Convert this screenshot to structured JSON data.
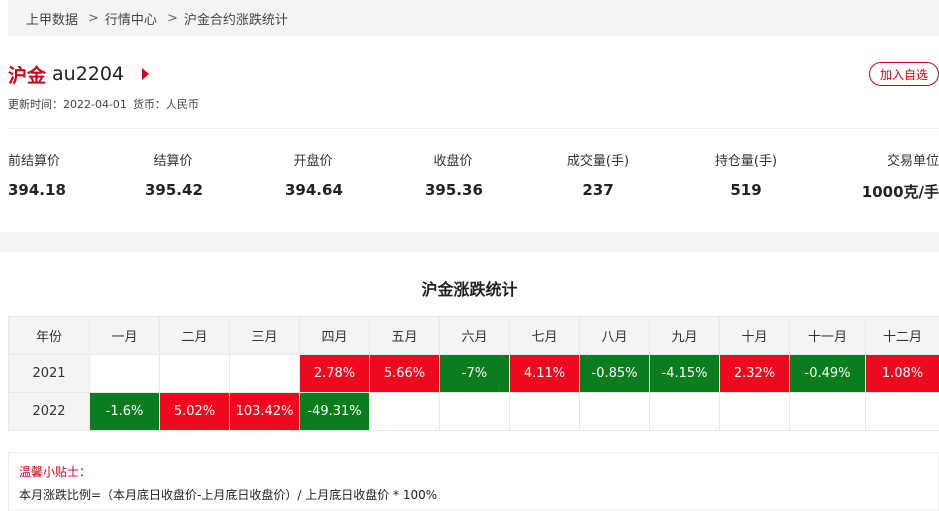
{
  "breadcrumb": {
    "items": [
      "上甲数据",
      "行情中心",
      "沪金合约涨跌统计"
    ],
    "separator": ">"
  },
  "contract": {
    "name": "沪金",
    "code": "au2204",
    "update_time": "更新时间：2022-04-01",
    "currency": "货币：人民币",
    "watch_button": "加入自选"
  },
  "stats": [
    {
      "label": "前结算价",
      "value": "394.18"
    },
    {
      "label": "结算价",
      "value": "395.42"
    },
    {
      "label": "开盘价",
      "value": "394.64"
    },
    {
      "label": "收盘价",
      "value": "395.36"
    },
    {
      "label": "成交量(手)",
      "value": "237"
    },
    {
      "label": "持仓量(手)",
      "value": "519"
    },
    {
      "label": "交易单位",
      "value": "1000克/手"
    }
  ],
  "table": {
    "title": "沪金涨跌统计",
    "headers": [
      "年份",
      "一月",
      "二月",
      "三月",
      "四月",
      "五月",
      "六月",
      "七月",
      "八月",
      "九月",
      "十月",
      "十一月",
      "十二月"
    ],
    "rows": [
      {
        "year": "2021",
        "cells": [
          "",
          "",
          "",
          "2.78%",
          "5.66%",
          "-7%",
          "4.11%",
          "-0.85%",
          "-4.15%",
          "2.32%",
          "-0.49%",
          "1.08%"
        ]
      },
      {
        "year": "2022",
        "cells": [
          "-1.6%",
          "5.02%",
          "103.42%",
          "-49.31%",
          "",
          "",
          "",
          "",
          "",
          "",
          "",
          ""
        ]
      }
    ]
  },
  "colors": {
    "accent": "#d0021b",
    "up": "#ee0a1e",
    "down": "#0b7d1e"
  },
  "tips": {
    "title": "温馨小贴士：",
    "content": "本月涨跌比例=（本月底日收盘价-上月底日收盘价）/ 上月底日收盘价 * 100%"
  }
}
